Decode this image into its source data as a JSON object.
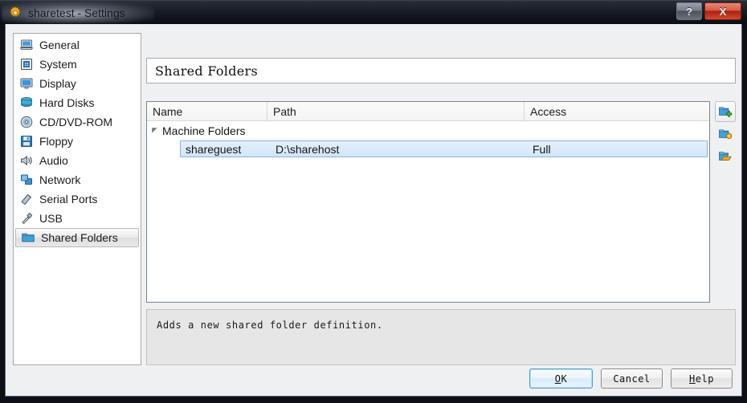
{
  "window": {
    "title": "sharetest - Settings",
    "icon": "gear-icon",
    "help_button_label": "?",
    "close_button_label": "X"
  },
  "sidebar": {
    "items": [
      {
        "label": "General",
        "icon": "computer-icon",
        "selected": false
      },
      {
        "label": "System",
        "icon": "chip-icon",
        "selected": false
      },
      {
        "label": "Display",
        "icon": "monitor-icon",
        "selected": false
      },
      {
        "label": "Hard Disks",
        "icon": "harddisk-icon",
        "selected": false
      },
      {
        "label": "CD/DVD-ROM",
        "icon": "cd-icon",
        "selected": false
      },
      {
        "label": "Floppy",
        "icon": "floppy-icon",
        "selected": false
      },
      {
        "label": "Audio",
        "icon": "speaker-icon",
        "selected": false
      },
      {
        "label": "Network",
        "icon": "network-icon",
        "selected": false
      },
      {
        "label": "Serial Ports",
        "icon": "serial-port-icon",
        "selected": false
      },
      {
        "label": "USB",
        "icon": "usb-icon",
        "selected": false
      },
      {
        "label": "Shared Folders",
        "icon": "folder-icon",
        "selected": true
      }
    ]
  },
  "pane": {
    "header": "Shared Folders",
    "table": {
      "columns": [
        "Name",
        "Path",
        "Access"
      ],
      "group": {
        "label": "Machine Folders",
        "expanded": true
      },
      "rows": [
        {
          "name": "shareguest",
          "path": "D:\\sharehost",
          "access": "Full",
          "selected": true
        }
      ]
    },
    "tools": [
      {
        "name": "add-shared-folder-button",
        "icon": "folder-add-icon",
        "active": true
      },
      {
        "name": "edit-shared-folder-button",
        "icon": "folder-edit-icon",
        "active": false
      },
      {
        "name": "remove-shared-folder-button",
        "icon": "folder-remove-icon",
        "active": false
      }
    ],
    "hint": "Adds a new shared folder definition."
  },
  "footer": {
    "ok": "OK",
    "cancel": "Cancel",
    "help": "Help"
  },
  "colors": {
    "selection_blue": "#d2e5f8",
    "selection_border": "#8bb4dd",
    "titlebar_dark": "#10151c",
    "close_red": "#a8230f",
    "dialog_bg": "#eff0f1"
  }
}
